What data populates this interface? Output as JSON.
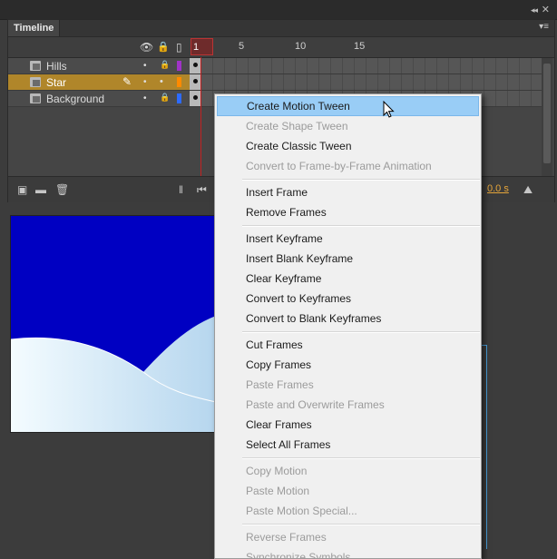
{
  "panel": {
    "tab_label": "Timeline",
    "collapse_glyph": "◂◂",
    "close_glyph": "✕",
    "menu_glyph": "▾≡"
  },
  "header_icons": {
    "eye": "👁",
    "lock": "🔒",
    "outline": "▯"
  },
  "frame_numbers": [
    {
      "label": "1",
      "frame": 1
    },
    {
      "label": "5",
      "frame": 5
    },
    {
      "label": "10",
      "frame": 10
    },
    {
      "label": "15",
      "frame": 15
    }
  ],
  "playhead_frame": "1",
  "layers": [
    {
      "name": "Hills",
      "selected": false,
      "color": "#a033c7"
    },
    {
      "name": "Star",
      "selected": true,
      "color": "#ff8a00"
    },
    {
      "name": "Background",
      "selected": false,
      "color": "#2d6bff"
    }
  ],
  "bottom": {
    "time_readout": "0.0 s"
  },
  "menu": {
    "items": [
      {
        "label": "Create Motion Tween",
        "state": "highlighted"
      },
      {
        "label": "Create Shape Tween",
        "state": "disabled"
      },
      {
        "label": "Create Classic Tween",
        "state": "enabled"
      },
      {
        "label": "Convert to Frame-by-Frame Animation",
        "state": "disabled"
      },
      {
        "separator": true
      },
      {
        "label": "Insert Frame",
        "state": "enabled"
      },
      {
        "label": "Remove Frames",
        "state": "enabled"
      },
      {
        "separator": true
      },
      {
        "label": "Insert Keyframe",
        "state": "enabled"
      },
      {
        "label": "Insert Blank Keyframe",
        "state": "enabled"
      },
      {
        "label": "Clear Keyframe",
        "state": "enabled"
      },
      {
        "label": "Convert to Keyframes",
        "state": "enabled"
      },
      {
        "label": "Convert to Blank Keyframes",
        "state": "enabled"
      },
      {
        "separator": true
      },
      {
        "label": "Cut Frames",
        "state": "enabled"
      },
      {
        "label": "Copy Frames",
        "state": "enabled"
      },
      {
        "label": "Paste Frames",
        "state": "disabled"
      },
      {
        "label": "Paste and Overwrite Frames",
        "state": "disabled"
      },
      {
        "label": "Clear Frames",
        "state": "enabled"
      },
      {
        "label": "Select All Frames",
        "state": "enabled"
      },
      {
        "separator": true
      },
      {
        "label": "Copy Motion",
        "state": "disabled"
      },
      {
        "label": "Paste Motion",
        "state": "disabled"
      },
      {
        "label": "Paste Motion Special...",
        "state": "disabled"
      },
      {
        "separator": true
      },
      {
        "label": "Reverse Frames",
        "state": "disabled"
      },
      {
        "label": "Synchronize Symbols",
        "state": "disabled"
      }
    ]
  },
  "colors": {
    "accent": "#99cdf6",
    "selected_layer": "#b0862a",
    "stage": "#0000c2",
    "playhead": "#c42121"
  }
}
